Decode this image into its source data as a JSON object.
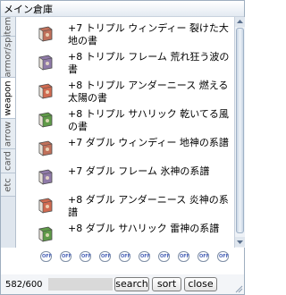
{
  "window": {
    "title": "メイン倉庫"
  },
  "tabs": [
    {
      "label": "item",
      "active": false
    },
    {
      "label": "armor/sp",
      "active": false
    },
    {
      "label": "weapon",
      "active": true
    },
    {
      "label": "arrow",
      "active": false
    },
    {
      "label": "card",
      "active": false
    },
    {
      "label": "etc",
      "active": false
    }
  ],
  "items": [
    {
      "name": "+7 トリプル ウィンディー 裂けた大地の書",
      "icon": "book-icon",
      "color": "#c0705a"
    },
    {
      "name": "+8 トリプル フレーム 荒れ狂う波の書",
      "icon": "book-icon",
      "color": "#8f7aa8"
    },
    {
      "name": "+8 トリプル アンダーニース 燃える太陽の書",
      "icon": "book-icon",
      "color": "#d06a50"
    },
    {
      "name": "+8 トリプル サハリック 乾いてる風の書",
      "icon": "book-icon",
      "color": "#5f9a48"
    },
    {
      "name": "+7 ダブル ウィンディー 地神の系譜",
      "icon": "book-icon",
      "color": "#c0705a"
    },
    {
      "name": "+7 ダブル フレーム 氷神の系譜",
      "icon": "book-icon",
      "color": "#8f7aa8"
    },
    {
      "name": "+8 ダブル アンダーニース 炎神の系譜",
      "icon": "book-icon",
      "color": "#d06a50"
    },
    {
      "name": "+8 ダブル サハリック 雷神の系譜",
      "icon": "book-icon",
      "color": "#5f9a48"
    }
  ],
  "filters": [
    "OFF",
    "OFF",
    "OFF",
    "OFF",
    "OFF",
    "OFF",
    "OFF",
    "OFF",
    "OFF",
    "OFF"
  ],
  "footer": {
    "count": "582/600",
    "search_value": "",
    "search_label": "search",
    "sort_label": "sort",
    "close_label": "close"
  }
}
